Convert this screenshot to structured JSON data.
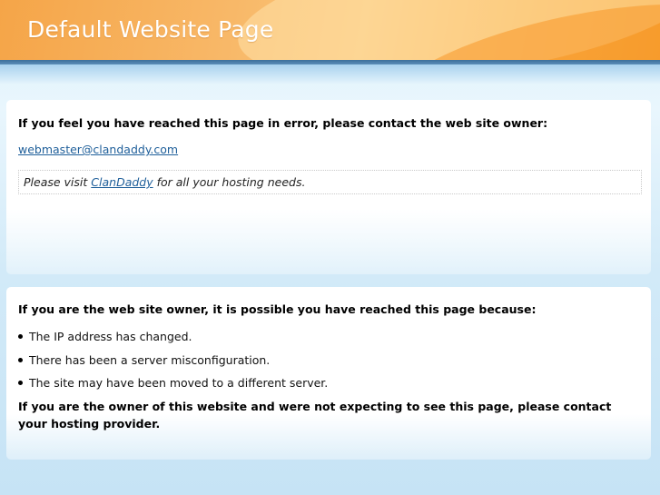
{
  "header": {
    "title": "Default Website Page"
  },
  "error_panel": {
    "heading": "If you feel you have reached this page in error, please contact the web site owner:",
    "email": "webmaster@clandaddy.com",
    "visit_prefix": "Please visit ",
    "visit_link": "ClanDaddy",
    "visit_suffix": " for all your hosting needs."
  },
  "owner_panel": {
    "heading": "If you are the web site owner, it is possible you have reached this page because:",
    "reasons": [
      "The IP address has changed.",
      "There has been a server misconfiguration.",
      "The site may have been moved to a different server."
    ],
    "footer": "If you are the owner of this website and were not expecting to see this page, please contact your hosting provider."
  },
  "colors": {
    "header_orange": "#f6a131",
    "band_blue": "#3c6f9a",
    "link_blue": "#1f5f9a",
    "background_blue": "#cfe7f6"
  }
}
